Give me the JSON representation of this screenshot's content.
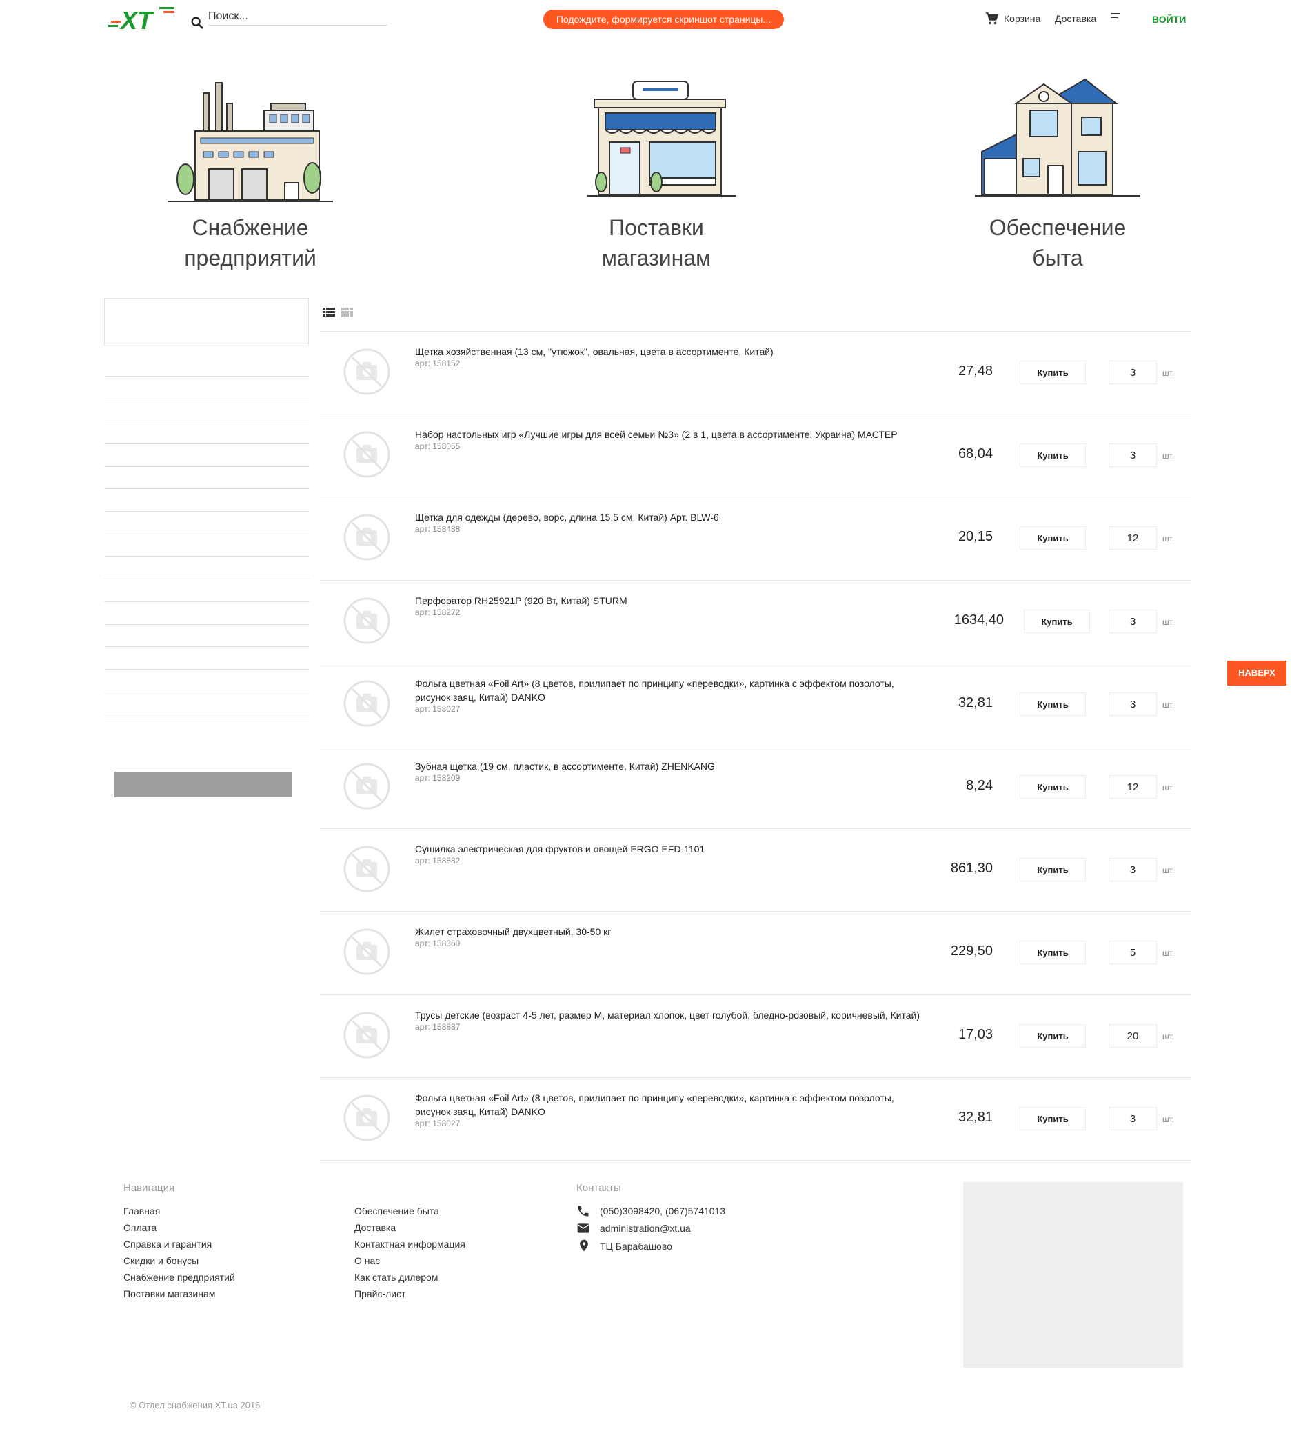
{
  "header": {
    "logo_text": "XT",
    "search_placeholder": "Поиск...",
    "notice": "Подождите, формируется скриншот страницы...",
    "cart": "Корзина",
    "delivery": "Доставка",
    "login": "ВОЙТИ"
  },
  "categories": [
    {
      "title": "Снабжение\nпредприятий"
    },
    {
      "title": "Поставки\nмагазинам"
    },
    {
      "title": "Обеспечение\nбыта"
    }
  ],
  "products": [
    {
      "name": "Щетка хозяйственная (13 см, \"утюжок\", овальная, цвета в ассортименте, Китай)",
      "art": "арт: 158152",
      "price": "27,48",
      "buy": "Купить",
      "qty": "3",
      "unit": "шт."
    },
    {
      "name": "Набор настольных игр «Лучшие игры для всей семьи №3» (2 в 1, цвета в ассортименте, Украина) МАСТЕР",
      "art": "арт: 158055",
      "price": "68,04",
      "buy": "Купить",
      "qty": "3",
      "unit": "шт."
    },
    {
      "name": "Щетка для одежды (дерево, ворс, длина 15,5 см, Китай) Арт. BLW-6",
      "art": "арт: 158488",
      "price": "20,15",
      "buy": "Купить",
      "qty": "12",
      "unit": "шт."
    },
    {
      "name": "Перфоратор RH25921P (920 Вт, Китай) STURM",
      "art": "арт: 158272",
      "price": "1634,40",
      "buy": "Купить",
      "qty": "3",
      "unit": "шт."
    },
    {
      "name": "Фольга цветная «Foil Art» (8 цветов, прилипает по принципу «переводки», картинка с эффектом позолоты, рисунок заяц, Китай) DANKO",
      "art": "арт: 158027",
      "price": "32,81",
      "buy": "Купить",
      "qty": "3",
      "unit": "шт."
    },
    {
      "name": "Зубная щетка (19 см, пластик, в ассортименте, Китай) ZHENKANG",
      "art": "арт: 158209",
      "price": "8,24",
      "buy": "Купить",
      "qty": "12",
      "unit": "шт."
    },
    {
      "name": "Сушилка электрическая для фруктов и овощей ERGO EFD-1101",
      "art": "арт: 158882",
      "price": "861,30",
      "buy": "Купить",
      "qty": "3",
      "unit": "шт."
    },
    {
      "name": "Жилет страховочный двухцветный, 30-50 кг",
      "art": "арт: 158360",
      "price": "229,50",
      "buy": "Купить",
      "qty": "5",
      "unit": "шт."
    },
    {
      "name": "Трусы детские (возраст 4-5 лет, размер M, материал хлопок, цвет голубой, бледно-розовый, коричневый, Китай)",
      "art": "арт: 158887",
      "price": "17,03",
      "buy": "Купить",
      "qty": "20",
      "unit": "шт."
    },
    {
      "name": "Фольга цветная «Foil Art» (8 цветов, прилипает по принципу «переводки», картинка с эффектом позолоты, рисунок заяц, Китай) DANKO",
      "art": "арт: 158027",
      "price": "32,81",
      "buy": "Купить",
      "qty": "3",
      "unit": "шт."
    }
  ],
  "back_to_top": "НАВЕРХ",
  "footer": {
    "nav_heading": "Навигация",
    "nav_col1": [
      "Главная",
      "Оплата",
      "Справка и гарантия",
      "Скидки и бонусы",
      "Снабжение предприятий",
      "Поставки магазинам"
    ],
    "nav_col2": [
      "Обеспечение быта",
      "Доставка",
      "Контактная информация",
      "О нас",
      "Как стать дилером",
      "Прайс-лист"
    ],
    "contacts_heading": "Контакты",
    "phone": "(050)3098420, (067)5741013",
    "email": "administration@xt.ua",
    "address": "ТЦ Барабашово",
    "copyright": "© Отдел снабжения XT.ua 2016"
  },
  "colors": {
    "accent": "#ff5722",
    "login": "#1a9a2b",
    "logo_green": "#1a9a2b",
    "logo_orange": "#ff5722"
  },
  "icons": [
    "search-icon",
    "cart-icon",
    "menu-icon",
    "list-view-icon",
    "grid-view-icon",
    "no-image-icon",
    "phone-icon",
    "email-icon",
    "location-icon"
  ]
}
